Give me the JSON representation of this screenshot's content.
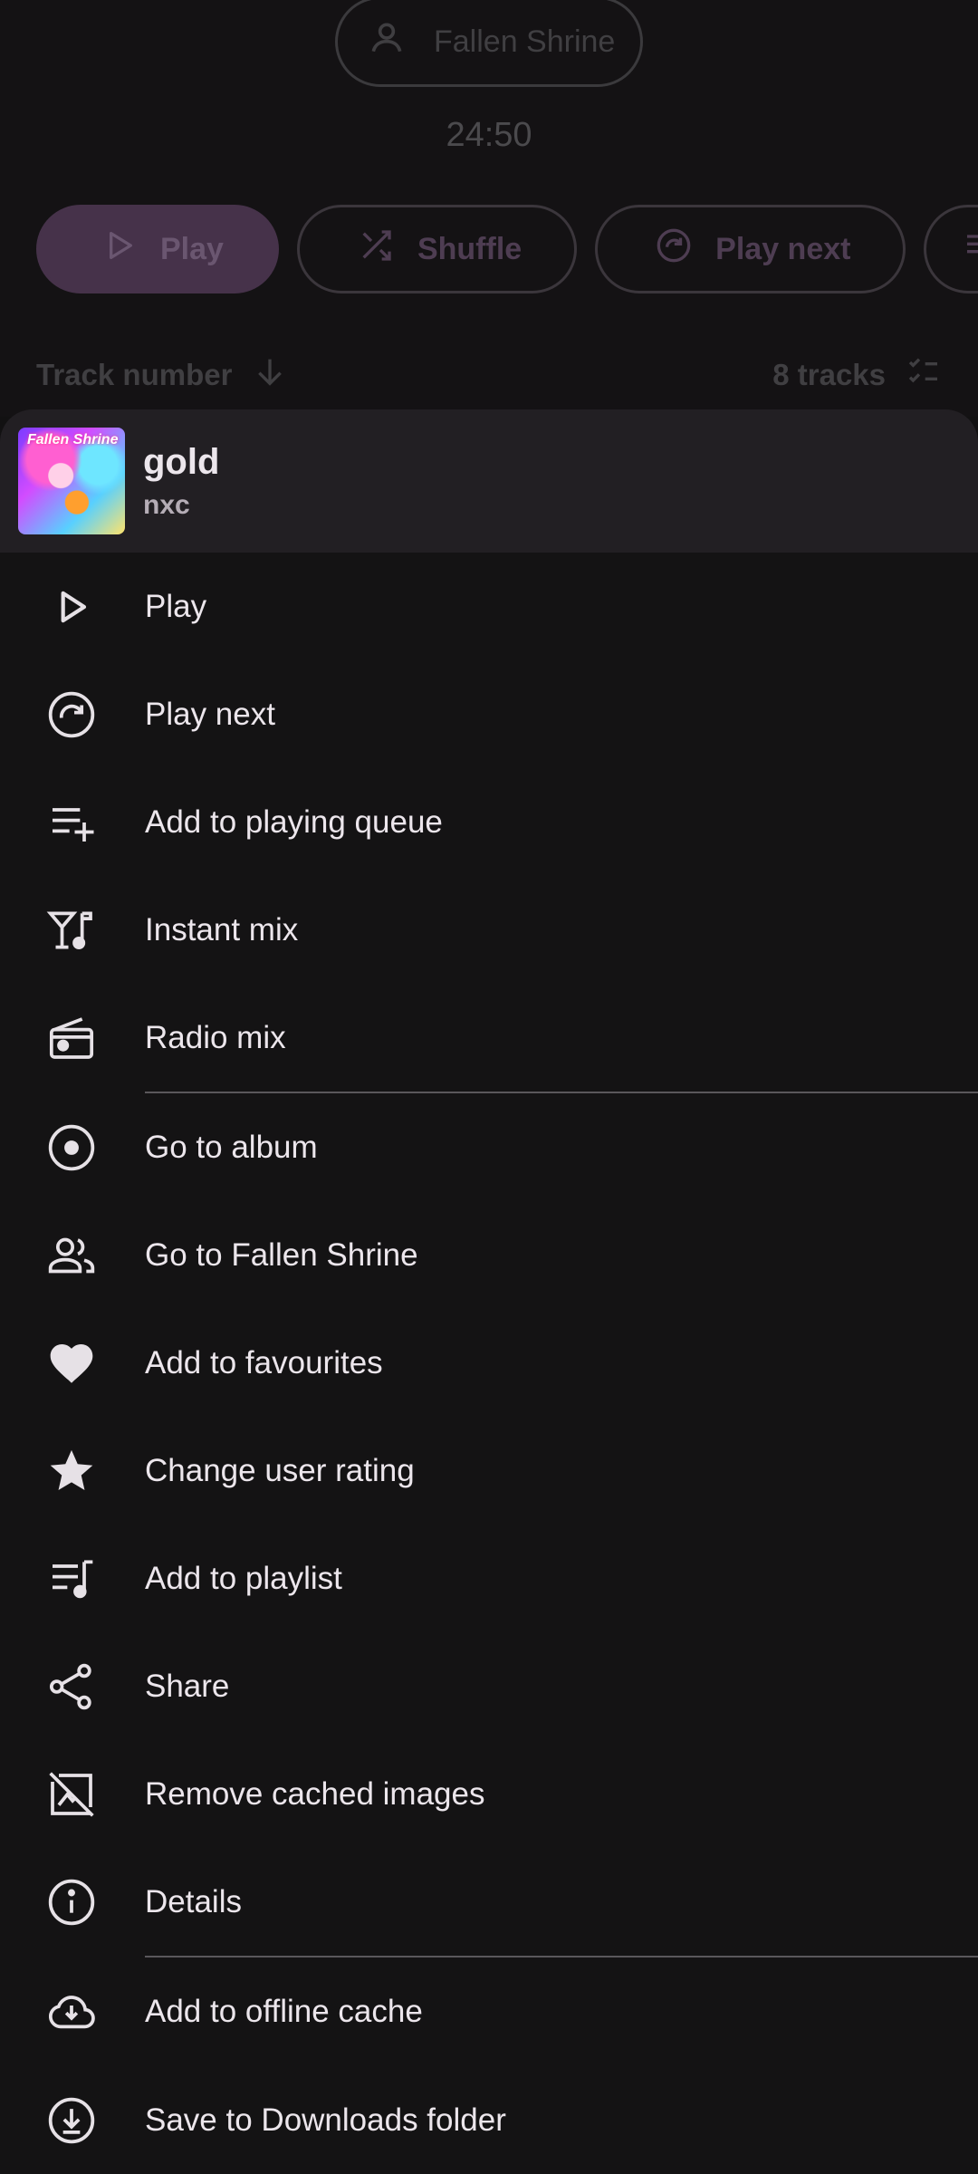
{
  "background": {
    "artist_pill": "Fallen Shrine",
    "duration": "24:50",
    "actions": [
      {
        "label": "Play",
        "icon": "play-icon"
      },
      {
        "label": "Shuffle",
        "icon": "shuffle-icon"
      },
      {
        "label": "Play next",
        "icon": "play-next-icon"
      },
      {
        "label": "",
        "icon": "queue-add-icon"
      }
    ],
    "sort_label": "Track number",
    "track_count": "8 tracks"
  },
  "sheet": {
    "title": "gold",
    "artist": "nxc",
    "cover_text": "Fallen Shrine",
    "items": [
      {
        "label": "Play",
        "icon": "play-icon"
      },
      {
        "label": "Play next",
        "icon": "play-next-icon"
      },
      {
        "label": "Add to playing queue",
        "icon": "queue-add-icon"
      },
      {
        "label": "Instant mix",
        "icon": "instant-mix-icon"
      },
      {
        "label": "Radio mix",
        "icon": "radio-icon"
      },
      {
        "label": "Go to album",
        "icon": "album-icon"
      },
      {
        "label": "Go to Fallen Shrine",
        "icon": "artist-icon"
      },
      {
        "label": "Add to favourites",
        "icon": "heart-icon"
      },
      {
        "label": "Change user rating",
        "icon": "star-icon"
      },
      {
        "label": "Add to playlist",
        "icon": "playlist-add-icon"
      },
      {
        "label": "Share",
        "icon": "share-icon"
      },
      {
        "label": "Remove cached images",
        "icon": "hide-image-icon"
      },
      {
        "label": "Details",
        "icon": "info-icon"
      },
      {
        "label": "Add to offline cache",
        "icon": "cloud-download-icon"
      },
      {
        "label": "Save to Downloads folder",
        "icon": "download-icon"
      }
    ]
  }
}
